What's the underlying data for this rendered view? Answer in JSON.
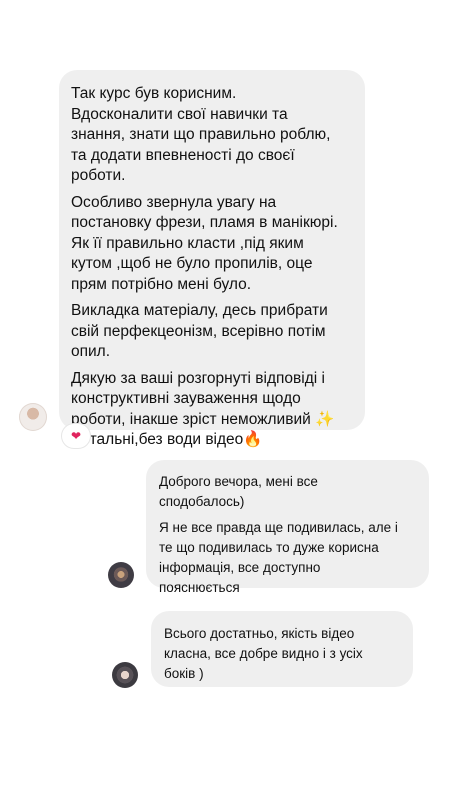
{
  "messages": [
    {
      "paragraphs": [
        "Так курс був корисним.\nВдосконалити свої навички та\nзнання, знати що правильно роблю,\nта додати впевненості до своєї\nроботи.",
        "Особливо звернула увагу на\nпостановку фрези, пламя в манікюрі.\nЯк її правильно класти ,під яким\nкутом ,щоб не було пропилів, оце\nпрям потрібно мені було.",
        "Викладка матеріалу, десь прибрати\nсвій перфекцеонізм, всерівно потім\nопил.",
        "Дякую за ваші розгорнуті відповіді і\nконструктивні зауваження щодо\nроботи, інакше зріст неможливий ✨\nДетальні,без води відео🔥"
      ],
      "reaction": "❤"
    },
    {
      "paragraphs": [
        "Доброго вечора, мені все\nсподобалось)",
        "Я не все правда ще подивилась, але і\nте що подивилась  то дуже корисна\nінформація, все доступно\nпояснюється"
      ]
    },
    {
      "paragraphs": [
        "Всього достатньо, якість відео\nкласна, все добре видно і з усіх\nбоків )"
      ]
    }
  ]
}
